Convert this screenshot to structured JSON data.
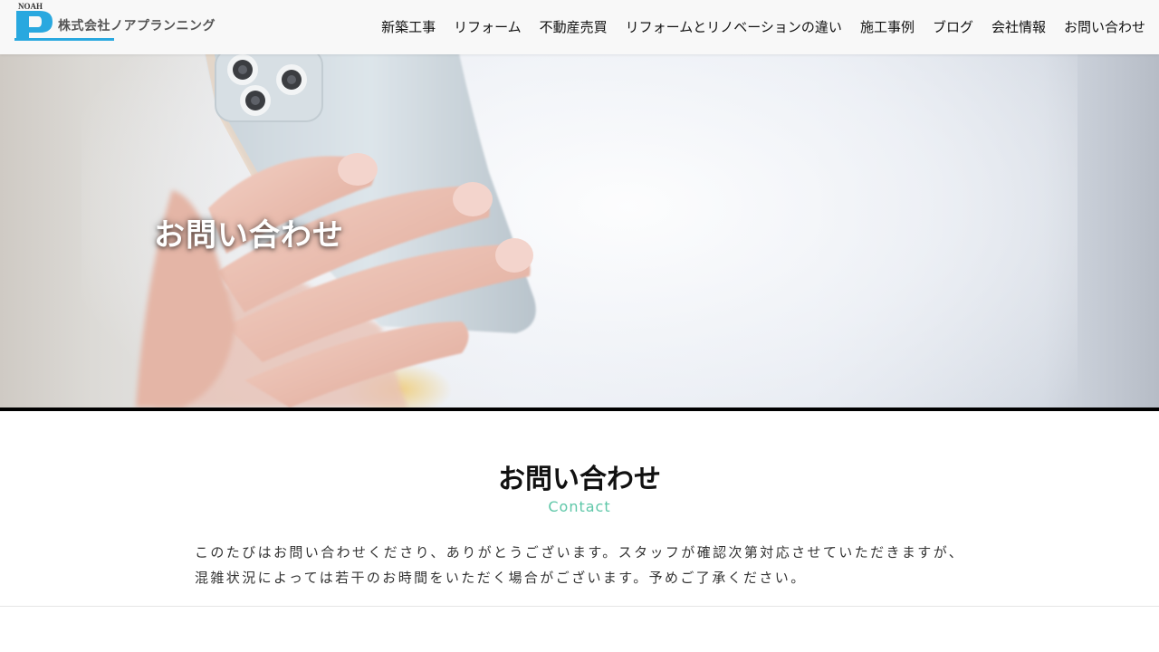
{
  "header": {
    "logo_small": "NOAH",
    "logo_text": "株式会社ノアプランニング",
    "logo_color": "#29a8df",
    "nav": [
      {
        "label": "新築工事"
      },
      {
        "label": "リフォーム"
      },
      {
        "label": "不動産売買"
      },
      {
        "label": "リフォームとリノベーションの違い"
      },
      {
        "label": "施工事例"
      },
      {
        "label": "ブログ"
      },
      {
        "label": "会社情報"
      },
      {
        "label": "お問い合わせ"
      }
    ]
  },
  "hero": {
    "title": "お問い合わせ",
    "image": "hand-holding-smartphone"
  },
  "section": {
    "title": "お問い合わせ",
    "subtitle": "Contact",
    "subtitle_color": "#5ec7a8",
    "intro_line1": "このたびはお問い合わせくださり、ありがとうございます。スタッフが確認次第対応させていただきますが、",
    "intro_line2": "混雑状況によっては若干のお時間をいただく場合がございます。予めご了承ください。"
  }
}
